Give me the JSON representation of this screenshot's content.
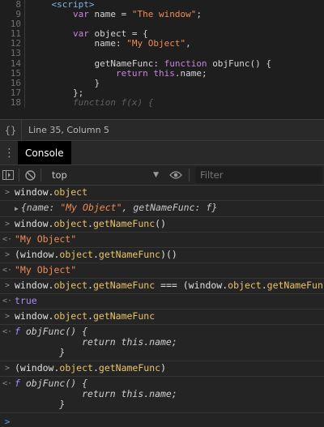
{
  "editor": {
    "lines": [
      {
        "num": "8",
        "tokens": [
          [
            "tag",
            "    <script>"
          ]
        ]
      },
      {
        "num": "9",
        "tokens": [
          [
            "kw",
            "        var "
          ],
          [
            "ident",
            "name = "
          ],
          [
            "str",
            "\"The window\""
          ],
          [
            "ident",
            ";"
          ]
        ]
      },
      {
        "num": "10",
        "tokens": [
          [
            "ident",
            ""
          ]
        ]
      },
      {
        "num": "11",
        "tokens": [
          [
            "kw",
            "        var "
          ],
          [
            "ident",
            "object = {"
          ]
        ]
      },
      {
        "num": "12",
        "tokens": [
          [
            "prop",
            "            name: "
          ],
          [
            "str",
            "\"My Object\""
          ],
          [
            "ident",
            ","
          ]
        ]
      },
      {
        "num": "13",
        "tokens": [
          [
            "ident",
            ""
          ]
        ]
      },
      {
        "num": "14",
        "tokens": [
          [
            "prop",
            "            getNameFunc: "
          ],
          [
            "kw",
            "function "
          ],
          [
            "fn-name",
            "objFunc() {"
          ]
        ]
      },
      {
        "num": "15",
        "tokens": [
          [
            "kw",
            "                return "
          ],
          [
            "this",
            "this"
          ],
          [
            "ident",
            ".name;"
          ]
        ]
      },
      {
        "num": "16",
        "tokens": [
          [
            "ident",
            "            }"
          ]
        ]
      },
      {
        "num": "17",
        "tokens": [
          [
            "ident",
            "        };"
          ]
        ]
      },
      {
        "num": "18",
        "tokens": [
          [
            "faded",
            "        function f(x) {"
          ]
        ]
      }
    ]
  },
  "status_bar": {
    "icon": "curly-braces-icon",
    "braces_glyph": "{}",
    "position_text": "Line 35, Column 5"
  },
  "drawer": {
    "menu_icon": "kebab-menu-icon",
    "active_tab": "Console"
  },
  "toolbar": {
    "context": "top",
    "filter_placeholder": "Filter"
  },
  "console": {
    "entries": [
      {
        "kind": "input",
        "text": "window.object"
      },
      {
        "kind": "object-preview",
        "open": "{",
        "pairs": [
          [
            "name",
            "\"My Object\""
          ],
          [
            "getNameFunc",
            "f"
          ]
        ],
        "close": "}"
      },
      {
        "kind": "input",
        "text": "window.object.getNameFunc()"
      },
      {
        "kind": "string",
        "text": "\"My Object\""
      },
      {
        "kind": "input",
        "text": "(window.object.getNameFunc)()"
      },
      {
        "kind": "string",
        "text": "\"My Object\""
      },
      {
        "kind": "input",
        "text": "window.object.getNameFunc === (window.object.getNameFunc)"
      },
      {
        "kind": "bool",
        "text": "true"
      },
      {
        "kind": "input",
        "text": "window.object.getNameFunc"
      },
      {
        "kind": "function",
        "lines": [
          "f objFunc() {",
          "            return this.name;",
          "        }"
        ]
      },
      {
        "kind": "input",
        "text": "(window.object.getNameFunc)"
      },
      {
        "kind": "function",
        "lines": [
          "f objFunc() {",
          "            return this.name;",
          "        }"
        ]
      }
    ],
    "prompt_glyph": ">",
    "input_glyph": ">",
    "result_glyph": "<·"
  }
}
